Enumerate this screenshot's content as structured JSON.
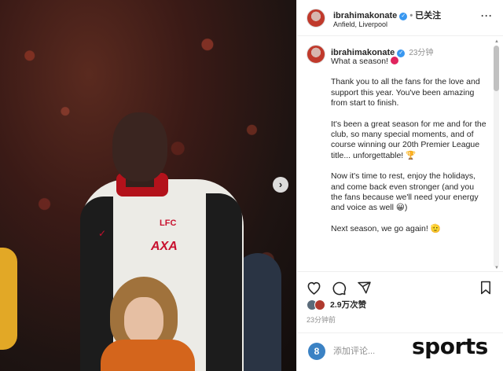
{
  "post": {
    "username": "ibrahimakonate",
    "follow_label": "已关注",
    "location": "Anfield, Liverpool",
    "caption_time": "23分钟",
    "caption_paragraphs": [
      "What a season!",
      "Thank you to all the fans for the love and support this year. You've been amazing from start to finish.",
      "It's been a great season for me and for the club, so many special moments, and of course winning our 20th Premier League title... unforgettable! 🏆",
      "Now it's time to rest, enjoy the holidays, and come back even stronger (and you the fans because we'll need your energy and voice as well 😀)",
      "Next season, we go again! 🫡"
    ],
    "likes": "2.9万次赞",
    "post_time": "23分钟前",
    "comment_placeholder": "添加评论...",
    "photo_crest": "LFC",
    "photo_sponsor": "AXA"
  },
  "watermark": "sports",
  "icons": {
    "verified": "verified-badge-icon",
    "more": "more-options-icon",
    "like": "heart-icon",
    "comment": "comment-icon",
    "share": "share-icon",
    "save": "bookmark-icon",
    "emoji": "emoji-icon",
    "next": "chevron-right-icon"
  },
  "colors": {
    "verified": "#3897f0",
    "border": "#efefef",
    "secondary_text": "#8e8e8e"
  }
}
